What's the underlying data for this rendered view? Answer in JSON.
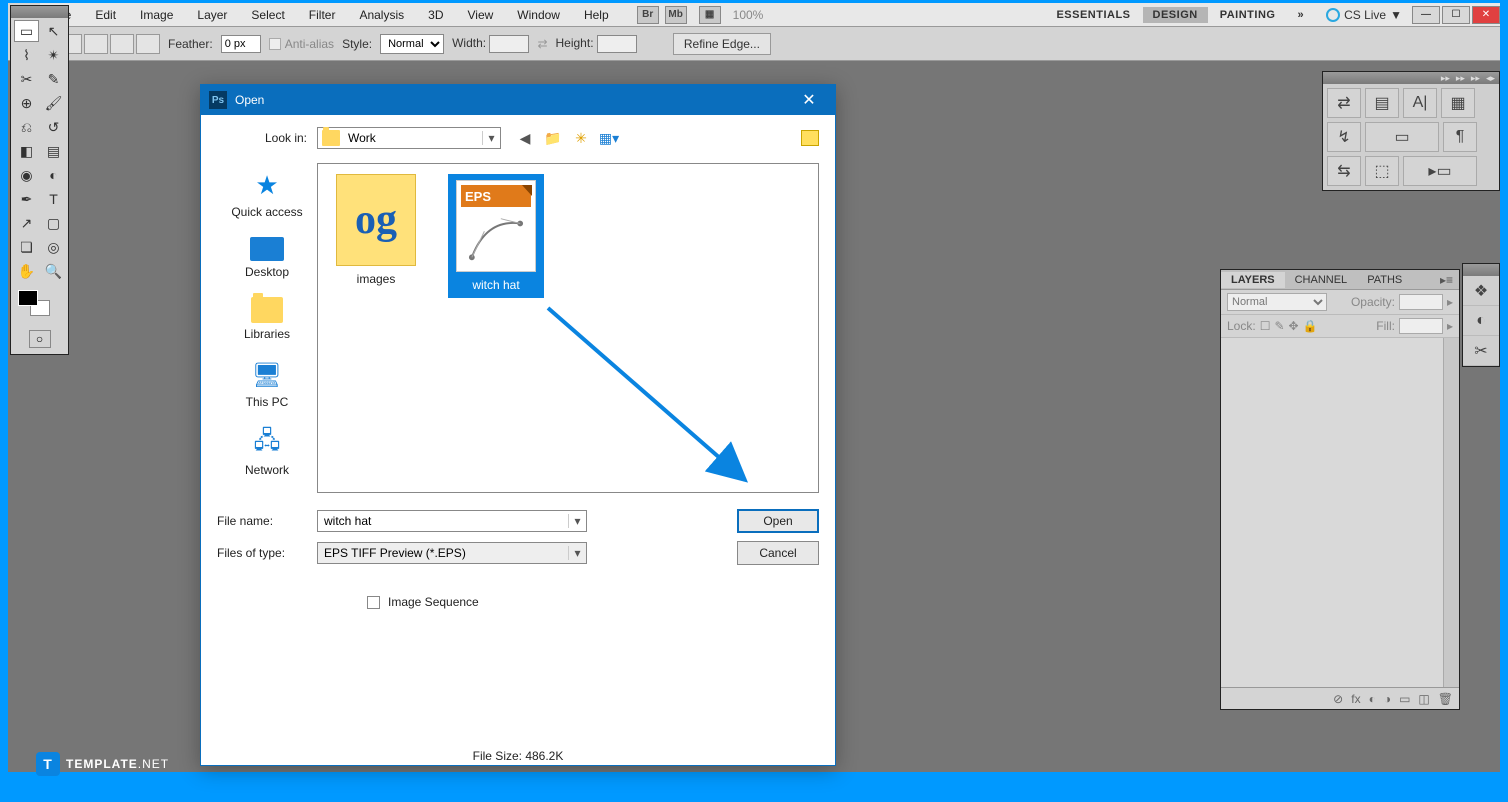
{
  "menu": {
    "items": [
      "File",
      "Edit",
      "Image",
      "Layer",
      "Select",
      "Filter",
      "Analysis",
      "3D",
      "View",
      "Window",
      "Help"
    ],
    "br": "Br",
    "mb": "Mb",
    "zoom": "100%",
    "workspaces": [
      "ESSENTIALS",
      "DESIGN",
      "PAINTING"
    ],
    "cslive": "CS Live"
  },
  "optbar": {
    "feather_label": "Feather:",
    "feather_value": "0 px",
    "antialias": "Anti-alias",
    "style_label": "Style:",
    "style_value": "Normal",
    "width_label": "Width:",
    "height_label": "Height:",
    "refine": "Refine Edge..."
  },
  "layers": {
    "tabs": [
      "LAYERS",
      "CHANNEL",
      "PATHS"
    ],
    "blend": "Normal",
    "opacity_label": "Opacity:",
    "lock_label": "Lock:",
    "fill_label": "Fill:"
  },
  "dialog": {
    "title": "Open",
    "lookin_label": "Look in:",
    "lookin_value": "Work",
    "places": [
      "Quick access",
      "Desktop",
      "Libraries",
      "This PC",
      "Network"
    ],
    "files": [
      {
        "name": "images",
        "type": "folder"
      },
      {
        "name": "witch hat",
        "type": "eps",
        "selected": true
      }
    ],
    "eps_badge": "EPS",
    "filename_label": "File name:",
    "filename_value": "witch hat",
    "filetype_label": "Files of type:",
    "filetype_value": "EPS TIFF Preview (*.EPS)",
    "image_sequence": "Image Sequence",
    "filesize": "File Size: 486.2K",
    "open_btn": "Open",
    "cancel_btn": "Cancel"
  },
  "watermark": {
    "brand1": "TEMPLATE",
    "brand2": ".NET"
  }
}
